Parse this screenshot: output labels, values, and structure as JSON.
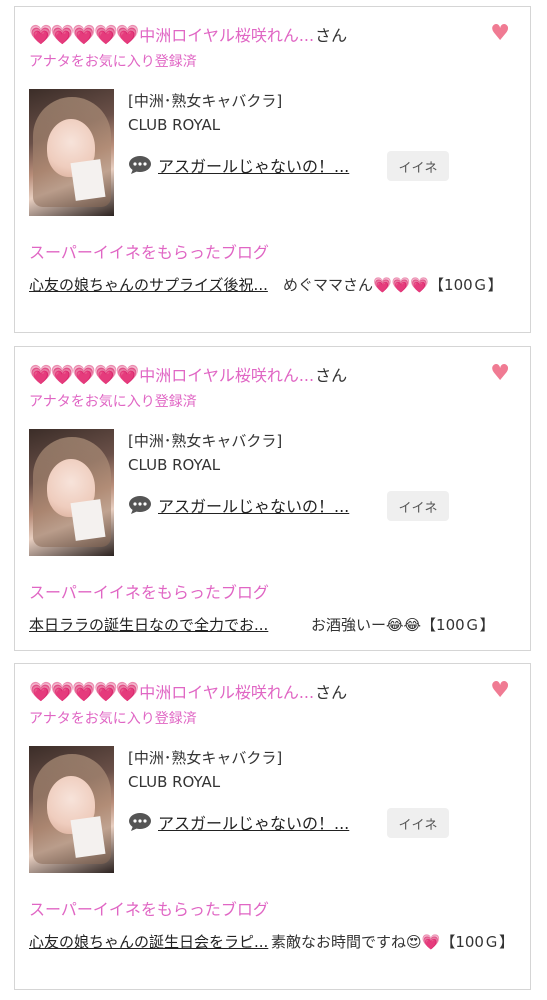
{
  "cards": [
    {
      "hearts": "💗💗💗💗💗",
      "sender": "中洲ロイヤル桜咲れん...",
      "suffix": "さん",
      "registered": "アナタをお気に入り登録済",
      "shop_category": "[中洲･熟女キャバクラ]",
      "shop_name": "CLUB ROYAL",
      "message": "アスガールじゃないの！...",
      "like_button": "イイネ",
      "super_label": "スーパーイイネをもらったブログ",
      "blog_title": "心友の娘ちゃんのサプライズ後祝...",
      "blog_comment": "めぐママさん💗💗💗【100Ｇ】"
    },
    {
      "hearts": "💗💗💗💗💗",
      "sender": "中洲ロイヤル桜咲れん...",
      "suffix": "さん",
      "registered": "アナタをお気に入り登録済",
      "shop_category": "[中洲･熟女キャバクラ]",
      "shop_name": "CLUB ROYAL",
      "message": "アスガールじゃないの！...",
      "like_button": "イイネ",
      "super_label": "スーパーイイネをもらったブログ",
      "blog_title": "本日ララの誕生日なので全力でお...",
      "blog_comment": "お酒強いー😂😂【100Ｇ】"
    },
    {
      "hearts": "💗💗💗💗💗",
      "sender": "中洲ロイヤル桜咲れん...",
      "suffix": "さん",
      "registered": "アナタをお気に入り登録済",
      "shop_category": "[中洲･熟女キャバクラ]",
      "shop_name": "CLUB ROYAL",
      "message": "アスガールじゃないの！...",
      "like_button": "イイネ",
      "super_label": "スーパーイイネをもらったブログ",
      "blog_title": "心友の娘ちゃんの誕生日会をラピ...",
      "blog_comment": "素敵なお時間ですね😍💗【100Ｇ】"
    }
  ]
}
